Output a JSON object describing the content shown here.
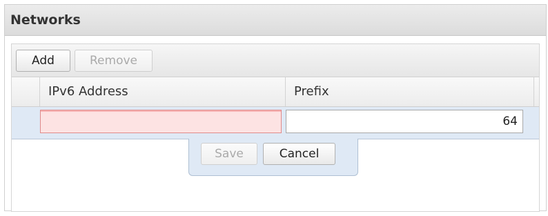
{
  "panel": {
    "title": "Networks"
  },
  "toolbar": {
    "add_label": "Add",
    "remove_label": "Remove"
  },
  "columns": [
    {
      "label": ""
    },
    {
      "label": "IPv6 Address"
    },
    {
      "label": "Prefix"
    }
  ],
  "editor": {
    "ipv6_value": "",
    "prefix_value": "64",
    "save_label": "Save",
    "cancel_label": "Cancel"
  }
}
